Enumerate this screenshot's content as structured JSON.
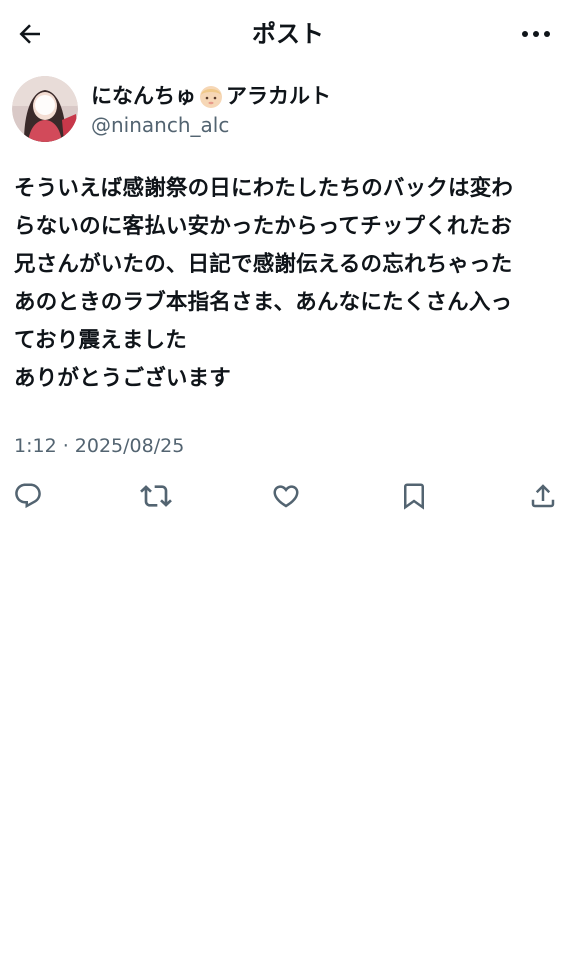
{
  "header": {
    "title": "ポスト"
  },
  "icons": {
    "back": "back-arrow-icon",
    "more": "more-options-icon",
    "reply": "reply-icon",
    "repost": "repost-icon",
    "like": "like-icon",
    "bookmark": "bookmark-icon",
    "share": "share-icon"
  },
  "author": {
    "name_prefix": "になんちゅ",
    "name_suffix": "アラカルト",
    "handle": "@ninanch_alc"
  },
  "post": {
    "lines": [
      "そういえば感謝祭の日にわたしたちのバックは変わ",
      "らないのに客払い安かったからってチップくれたお",
      "兄さんがいたの、日記で感謝伝えるの忘れちゃった",
      "あのときのラブ本指名さま、あんなにたくさん入っ",
      "ており震えました",
      "ありがとうございます"
    ],
    "timestamp": "1:12 · 2025/08/25"
  },
  "colors": {
    "text": "#0f1419",
    "secondary": "#536471",
    "background": "#ffffff"
  }
}
